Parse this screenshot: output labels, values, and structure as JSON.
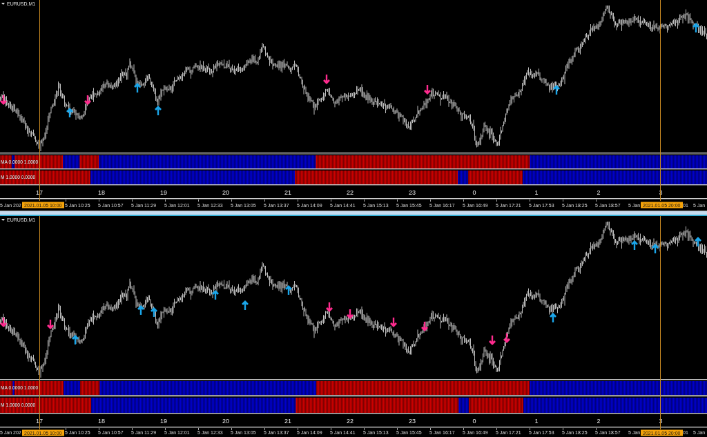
{
  "charts": [
    {
      "title": "EURUSD,M1",
      "indicators": [
        {
          "label": "MA 0.0000 1.0000",
          "segments": [
            {
              "color": "#cc0000"
            },
            {
              "color": "#0000cc"
            },
            {
              "color": "#cc0000"
            },
            {
              "color": "#0000cc"
            },
            {
              "color": "#cc0000"
            },
            {
              "color": "#0000cc"
            },
            {
              "color": "#cc0000"
            },
            {
              "color": "#0000cc"
            }
          ]
        },
        {
          "label": "M 1.0000 0.0000",
          "segments": [
            {
              "color": "#cc0000"
            },
            {
              "color": "#0000cc"
            },
            {
              "color": "#cc0000"
            },
            {
              "color": "#0000cc"
            },
            {
              "color": "#cc0000"
            },
            {
              "color": "#0000cc"
            }
          ]
        }
      ],
      "hours": [
        "17",
        "18",
        "19",
        "20",
        "21",
        "22",
        "23",
        "0",
        "1",
        "2",
        "3"
      ],
      "time_axis": {
        "labels": [
          "5 Jan 202",
          "5 Jan 10:25",
          "5 Jan 10:57",
          "5 Jan 11:29",
          "5 Jan 12:01",
          "5 Jan 12:33",
          "5 Jan 13:05",
          "5 Jan 13:37",
          "5 Jan 14:09",
          "5 Jan 14:41",
          "5 Jan 15:13",
          "5 Jan 15:45",
          "5 Jan 16:17",
          "5 Jan 16:49",
          "5 Jan 17:21",
          "5 Jan 17:53",
          "5 Jan 18:25",
          "5 Jan 18:57",
          "5 Jan",
          "01",
          "5 Jan"
        ],
        "markers": [
          "2021.01.05 10:00",
          "2021.01.05 20:00"
        ]
      }
    },
    {
      "title": "EURUSD,M1",
      "indicators": [
        {
          "label": "MA 0.0000 1.0000",
          "segments": [
            {
              "color": "#cc0000"
            },
            {
              "color": "#0000cc"
            },
            {
              "color": "#cc0000"
            },
            {
              "color": "#0000cc"
            },
            {
              "color": "#cc0000"
            },
            {
              "color": "#0000cc"
            },
            {
              "color": "#cc0000"
            },
            {
              "color": "#0000cc"
            }
          ]
        },
        {
          "label": "M 1.0000 0.0000",
          "segments": [
            {
              "color": "#cc0000"
            },
            {
              "color": "#0000cc"
            },
            {
              "color": "#cc0000"
            },
            {
              "color": "#0000cc"
            },
            {
              "color": "#cc0000"
            },
            {
              "color": "#0000cc"
            }
          ]
        }
      ],
      "hours": [
        "17",
        "18",
        "19",
        "20",
        "21",
        "22",
        "23",
        "0",
        "1",
        "2",
        "3"
      ],
      "time_axis": {
        "labels": [
          "5 Jan 202",
          "5 Jan 10:25",
          "5 Jan 10:57",
          "5 Jan 11:29",
          "5 Jan 12:01",
          "5 Jan 12:33",
          "5 Jan 13:05",
          "5 Jan 13:37",
          "5 Jan 14:09",
          "5 Jan 14:41",
          "5 Jan 15:13",
          "5 Jan 15:45",
          "5 Jan 16:17",
          "5 Jan 16:49",
          "5 Jan 17:21",
          "5 Jan 17:53",
          "5 Jan 18:25",
          "5 Jan 18:57",
          "5 Jan",
          "01",
          "5 Jan"
        ],
        "markers": [
          "2021.01.05 10:00",
          "2021.01.05 20:00"
        ]
      }
    }
  ]
}
